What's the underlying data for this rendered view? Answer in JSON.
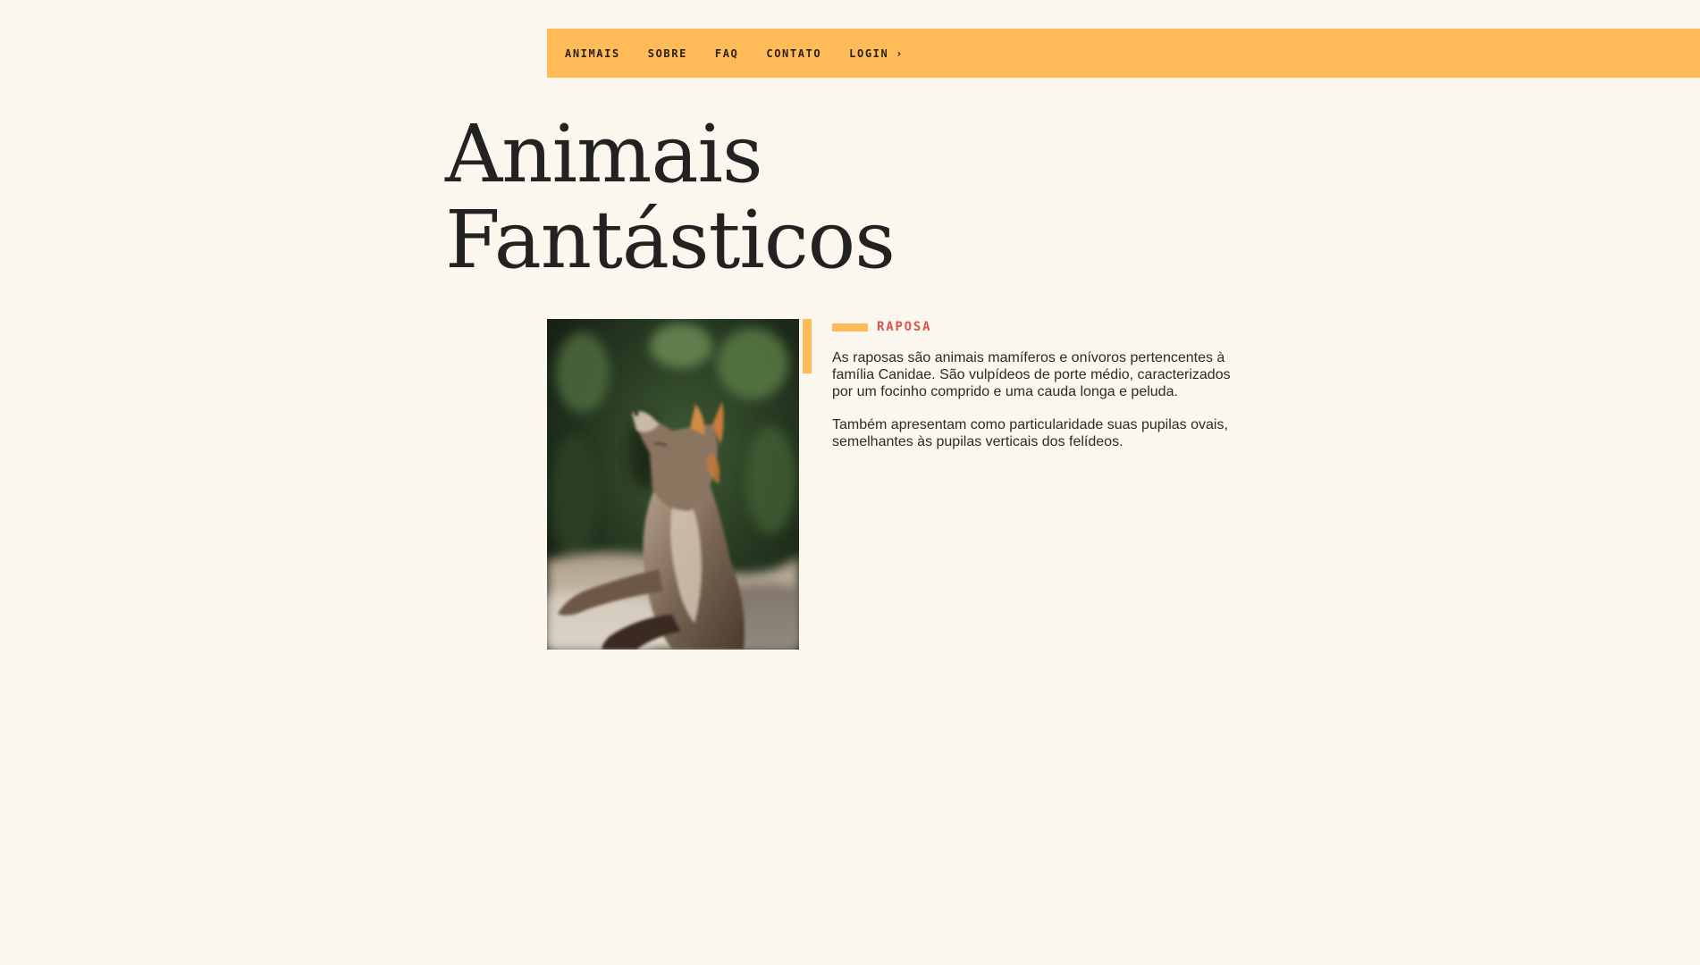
{
  "nav": {
    "items": [
      {
        "label": "ANIMAIS"
      },
      {
        "label": "SOBRE"
      },
      {
        "label": "FAQ"
      },
      {
        "label": "CONTATO"
      },
      {
        "label": "LOGIN",
        "chevron": "›"
      }
    ]
  },
  "hero": {
    "title_line1": "Animais",
    "title_line2": "Fantásticos"
  },
  "article": {
    "label": "RAPOSA",
    "paragraphs": [
      "As raposas são animais mamíferos e onívoros pertencentes à família Canidae. São vulpídeos de porte médio, caracterizados por um focinho comprido e uma cauda longa e peluda.",
      "Também apresentam como particularidade suas pupilas ovais, semelhantes às pupilas verticais dos felídeos."
    ],
    "image_icon": "fox-photo"
  },
  "colors": {
    "background": "#fbf6ee",
    "accent": "#ffbb57",
    "label": "#d8574a",
    "text": "#2b2b2b"
  }
}
